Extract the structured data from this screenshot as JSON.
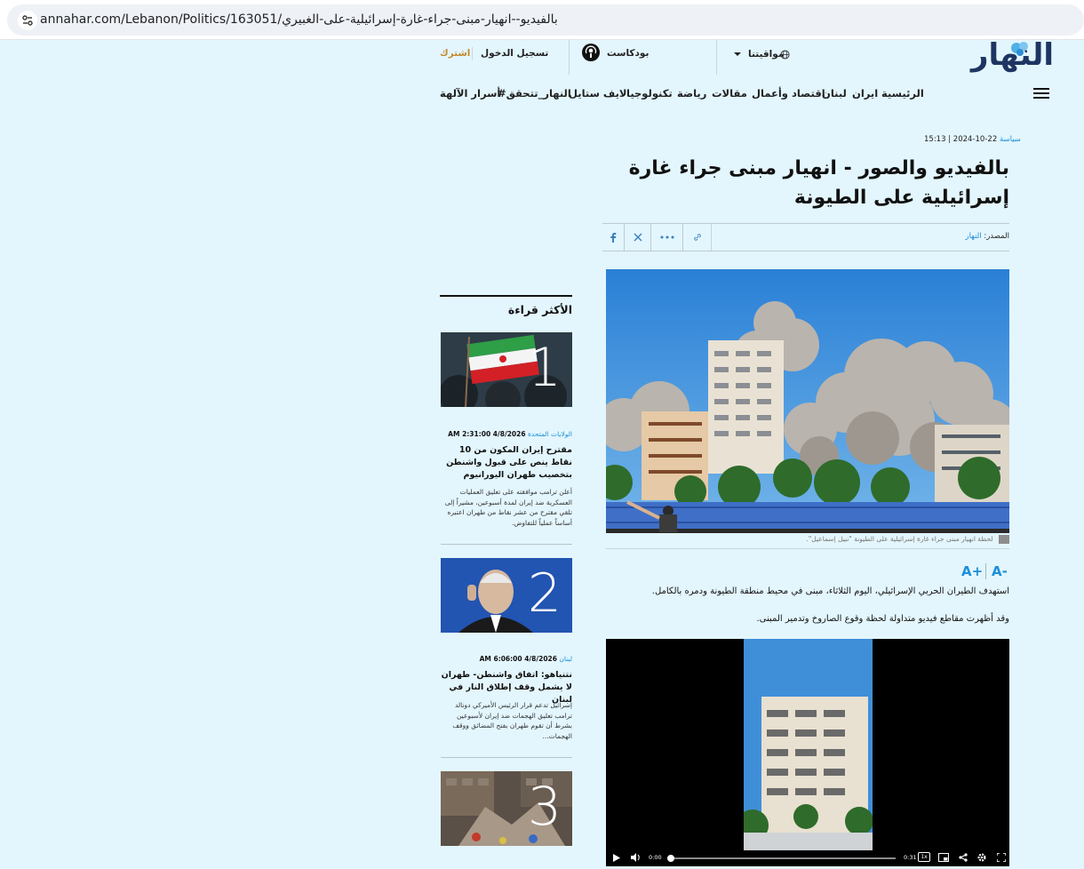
{
  "browser": {
    "url": "annahar.com/Lebanon/Politics/163051/بالفيديو--انهيار-مبنى-جراء-غارة-إسرائيلية-على-الغبيري"
  },
  "header": {
    "logo": "النهار",
    "subscribe": "اشترك",
    "login": "تسجيل الدخول",
    "podcast": "بودكاست",
    "timings": "مواقيتنا",
    "nav": [
      "الرئيسية",
      "ايران",
      "لبنان",
      "اقتصاد وأعمال",
      "مقالات",
      "رياضة",
      "تكنولوجيا",
      "لايف ستايل",
      "#النهار_تتحقق",
      "أسرار الآلهة"
    ]
  },
  "article": {
    "category": "سياسة",
    "date": "22-10-2024 | 15:13",
    "title": "بالفيديو والصور - انهيار مبنى جراء غارة إسرائيلية على الطيونة",
    "source_label": "المصدر:",
    "source": "النهار",
    "caption": "لحظة انهيار مبنى جراء غارة إسرائيلية على الطيونة \"نبيل إسماعيل\".",
    "font_increase": "A+",
    "font_decrease": "A-",
    "paragraphs": [
      "استهدف الطيران الحربي الإسرائيلي، اليوم الثلاثاء، مبنى في محيط منطقة الطيونة ودمره بالكامل.",
      "وقد أظهرت مقاطع فيديو متداولة لحظة وقوع الصاروخ وتدمير المبنى."
    ],
    "video": {
      "current_time": "0:00",
      "duration": "0:31",
      "speed": "1x",
      "progress": 0.0
    }
  },
  "sidebar": {
    "title": "الأكثر قراءة",
    "items": [
      {
        "rank": "1",
        "category": "الولايات المتحدة",
        "date": "4/8/2026 2:31:00 AM",
        "headline": "مقترح إيران المكون من 10 نقاط ينص على قبول واشنطن بتخصيب طهران اليورانيوم",
        "summary": "أعلن ترامب موافقته على تعليق العمليات العسكرية ضد إيران لمدة أسبوعين، مشيراً إلى تلقي مقترح من عشر نقاط من طهران اعتبره أساساً عملياً للتفاوض."
      },
      {
        "rank": "2",
        "category": "لبنان",
        "date": "4/8/2026 6:06:00 AM",
        "headline": "نتنياهو: اتفاق واشنطن- طهران لا يشمل وقف إطلاق النار في لبنان",
        "summary": "إسرائيل تدعم قرار الرئيس الأميركي دونالد ترامب تعليق الهجمات ضد إيران لأسبوعين بشرط أن تقوم طهران بفتح المضائق ووقف الهجمات..."
      },
      {
        "rank": "3"
      }
    ]
  },
  "colors": {
    "background": "#e3f6fd",
    "accent": "#1c8fd9",
    "logo": "#1e3563",
    "subscribe": "#c38a2d"
  },
  "icons": [
    "tune-icon",
    "globe-icon",
    "chevron-down-icon",
    "podcast-icon",
    "menu-icon",
    "facebook-icon",
    "x-icon",
    "more-icon",
    "link-icon",
    "play-icon",
    "volume-icon",
    "captions-icon",
    "miniplayer-icon",
    "share-icon",
    "settings-icon",
    "fullscreen-icon"
  ]
}
